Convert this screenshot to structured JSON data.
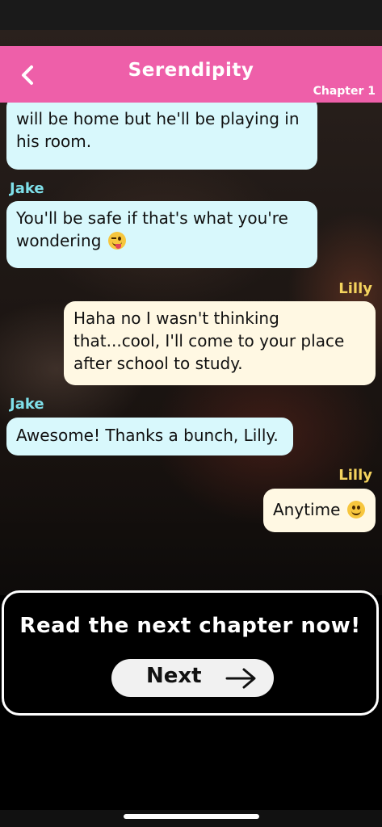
{
  "header": {
    "title": "Serendipity",
    "chapter": "Chapter 1"
  },
  "chat": {
    "messages": [
      {
        "speaker": "",
        "text": "will be home but he'll be playing in his room."
      },
      {
        "speaker": "Jake",
        "text": "You'll be safe if that's what you're wondering",
        "emoji": "zany-face-icon"
      },
      {
        "speaker": "Lilly",
        "text": "Haha no I wasn't thinking that...cool, I'll come to your place after school to study."
      },
      {
        "speaker": "Jake",
        "text": "Awesome! Thanks a bunch, Lilly."
      },
      {
        "speaker": "Lilly",
        "text": "Anytime",
        "emoji": "smiling-face-icon"
      }
    ]
  },
  "cta": {
    "prompt": "Read the next chapter now!",
    "next_label": "Next"
  },
  "colors": {
    "header": "#ee5fa9",
    "jake_bubble": "#d8f8fc",
    "lilly_bubble": "#fff8e3",
    "jake_name": "#7fe0ea",
    "lilly_name": "#f4d35e"
  }
}
